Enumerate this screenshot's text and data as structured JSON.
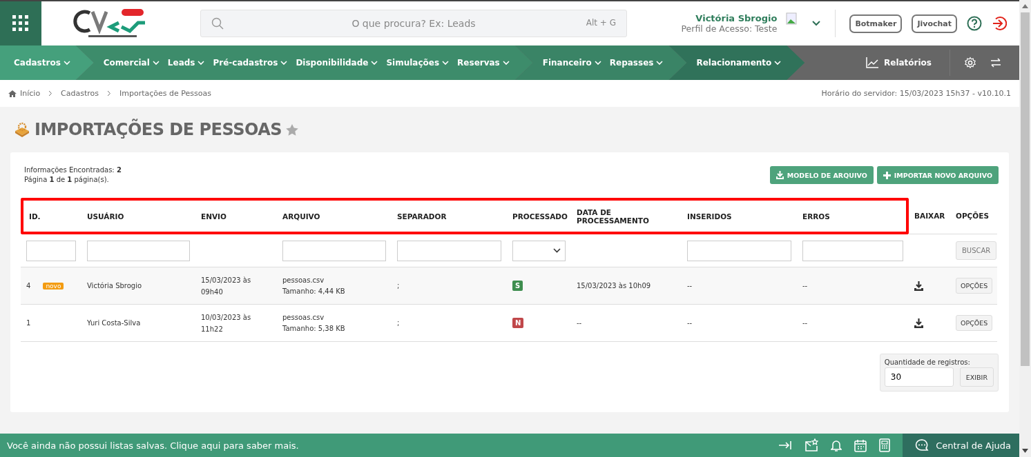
{
  "header": {
    "search": {
      "placeholder": "O que procura? Ex: Leads",
      "shortcut": "Alt + G"
    },
    "user": {
      "name": "Victória Sbrogio",
      "profile": "Perfil de Acesso: Teste"
    },
    "buttons": [
      "Botmaker",
      "Jivochat"
    ]
  },
  "nav": {
    "groups": [
      {
        "color": "#45a07c",
        "items": [
          "Cadastros"
        ]
      },
      {
        "color": "#3d8c6b",
        "items": [
          "Comercial",
          "Leads",
          "Pré-cadastros",
          "Disponibilidade",
          "Simulações",
          "Reservas"
        ]
      },
      {
        "color": "#3a8466",
        "items": [
          "Financeiro",
          "Repasses"
        ]
      },
      {
        "color": "#30725a",
        "items": [
          "Relacionamento"
        ]
      }
    ],
    "reports": "Relatórios"
  },
  "breadcrumb": [
    "Início",
    "Cadastros",
    "Importações de Pessoas"
  ],
  "server_time": "Horário do servidor: 15/03/2023 15h37 - v10.10.1",
  "page_title": "IMPORTAÇÕES DE PESSOAS",
  "summary": [
    "Informações Encontradas: **2**",
    "Página **1** de **1** página(s)."
  ],
  "actions": [
    {
      "kind": "download",
      "label": "MODELO DE ARQUIVO"
    },
    {
      "kind": "add",
      "label": "IMPORTAR NOVO ARQUIVO"
    }
  ],
  "table": {
    "columns": [
      {
        "label": "ID.",
        "highlighted": true,
        "kind": "input"
      },
      {
        "label": "USUÁRIO",
        "highlighted": true,
        "kind": "input"
      },
      {
        "label": "ENVIO",
        "highlighted": true,
        "kind": "plain"
      },
      {
        "label": "ARQUIVO",
        "highlighted": true,
        "kind": "input"
      },
      {
        "label": "SEPARADOR",
        "highlighted": true,
        "kind": "input"
      },
      {
        "label": "PROCESSADO",
        "highlighted": true,
        "kind": "select"
      },
      {
        "label": "DATA DE PROCESSAMENTO",
        "highlighted": true,
        "kind": "plain"
      },
      {
        "label": "INSERIDOS",
        "highlighted": true,
        "kind": "input"
      },
      {
        "label": "ERROS",
        "highlighted": true,
        "kind": "input"
      },
      {
        "label": "BAIXAR",
        "highlighted": false,
        "kind": "plain"
      },
      {
        "label": "OPÇÕES",
        "highlighted": false,
        "kind": "button"
      }
    ],
    "search_button": "BUSCAR",
    "rows": [
      {
        "id": "4",
        "badge": "novo",
        "user": "Victória Sbrogio",
        "sent": "15/03/2023 às 09h40",
        "file": "pessoas.csv",
        "size": "Tamanho: 4,44 KB",
        "separator": ";",
        "processed": {
          "text": "S",
          "color": "#3e8e4f"
        },
        "processed_at": "15/03/2023 às 10h09",
        "inserted": "--",
        "errors": "--",
        "options": "OPÇÕES"
      },
      {
        "id": "1",
        "user": "Yuri Costa-Silva",
        "sent": "10/03/2023 às 11h22",
        "file": "pessoas.csv",
        "size": "Tamanho: 5,38 KB",
        "separator": ";",
        "processed": {
          "text": "N",
          "color": "#c0474a"
        },
        "processed_at": "--",
        "inserted": "--",
        "errors": "--",
        "options": "OPÇÕES"
      }
    ]
  },
  "records": {
    "label": "Quantidade de registros:",
    "value": "30",
    "button": "EXIBIR"
  },
  "footer": {
    "message": "Você ainda não possui listas salvas. Clique aqui para saber mais.",
    "help": "Central de Ajuda"
  }
}
